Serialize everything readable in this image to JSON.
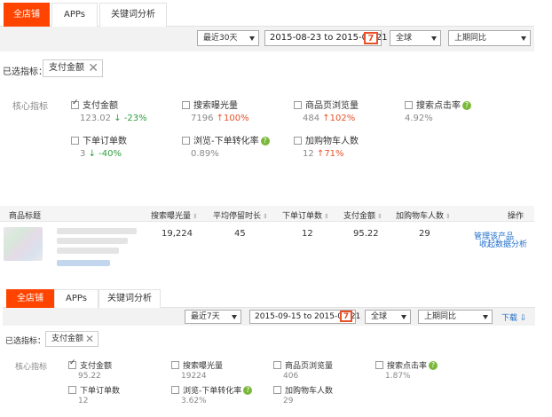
{
  "panel1": {
    "tabs": [
      "全店铺",
      "APPs",
      "关键词分析"
    ],
    "filters": {
      "period": "最近30天",
      "date_range": "2015-08-23 to 2015-09-21",
      "calendar_glyph": "7",
      "region": "全球",
      "compare": "上期同比"
    },
    "chosen_label": "已选指标：",
    "chosen_chip": "支付金额",
    "core_label": "核心指标",
    "metrics": [
      {
        "name": "支付金额",
        "checked": true,
        "value": "123.02",
        "delta": "-23%",
        "dir": "down"
      },
      {
        "name": "搜索曝光量",
        "checked": false,
        "value": "7196",
        "delta": "100%",
        "dir": "up"
      },
      {
        "name": "商品页浏览量",
        "checked": false,
        "value": "484",
        "delta": "102%",
        "dir": "up"
      },
      {
        "name": "搜索点击率",
        "checked": false,
        "value": "4.92%",
        "delta": "",
        "dir": "",
        "help": true
      },
      {
        "name": "下单订单数",
        "checked": false,
        "value": "3",
        "delta": "-40%",
        "dir": "down"
      },
      {
        "name": "浏览-下单转化率",
        "checked": false,
        "value": "0.89%",
        "delta": "",
        "dir": "",
        "help": true
      },
      {
        "name": "加购物车人数",
        "checked": false,
        "value": "12",
        "delta": "71%",
        "dir": "up"
      }
    ],
    "table": {
      "headers": [
        "商品标题",
        "搜索曝光量",
        "平均停留时长",
        "下单订单数",
        "支付金额",
        "加购物车人数",
        "操作"
      ],
      "row": {
        "exposure": "19,224",
        "avg_stay": "45",
        "orders": "12",
        "payment": "95.22",
        "cart": "29"
      },
      "actions": [
        "管理该产品",
        "收起数据分析"
      ]
    }
  },
  "panel2": {
    "tabs": [
      "全店铺",
      "APPs",
      "关键词分析"
    ],
    "filters": {
      "period": "最近7天",
      "date_range": "2015-09-15 to 2015-09-21",
      "calendar_glyph": "7",
      "region": "全球",
      "compare": "上期同比",
      "download": "下载"
    },
    "chosen_label": "已选指标：",
    "chosen_chip": "支付金额",
    "core_label": "核心指标",
    "metrics": [
      {
        "name": "支付金额",
        "checked": true,
        "value": "95.22"
      },
      {
        "name": "搜索曝光量",
        "checked": false,
        "value": "19224"
      },
      {
        "name": "商品页浏览量",
        "checked": false,
        "value": "406"
      },
      {
        "name": "搜索点击率",
        "checked": false,
        "value": "1.87%",
        "help": true
      },
      {
        "name": "下单订单数",
        "checked": false,
        "value": "12"
      },
      {
        "name": "浏览-下单转化率",
        "checked": false,
        "value": "3.62%",
        "help": true
      },
      {
        "name": "加购物车人数",
        "checked": false,
        "value": "29"
      }
    ]
  },
  "colors": {
    "accent": "#ff4400",
    "link": "#1d6cc9",
    "down": "#2e9e3e",
    "up": "#e8512a",
    "help": "#7ab83a"
  }
}
